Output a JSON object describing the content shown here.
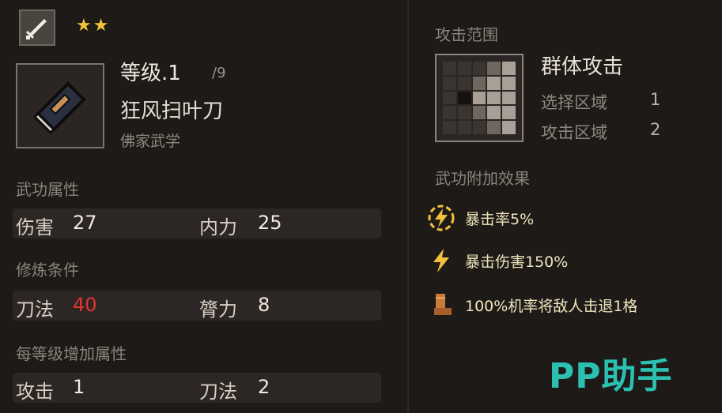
{
  "header": {
    "weapon_icon": "sword-icon",
    "stars": "★★"
  },
  "skill": {
    "book_icon": "book-icon",
    "level": "等级.1",
    "level_max": "/9",
    "name": "狂风扫叶刀",
    "school": "佛家武学"
  },
  "attributes": {
    "label": "武功属性",
    "items": [
      {
        "key": "伤害",
        "value": "27"
      },
      {
        "key": "内力",
        "value": "25"
      }
    ]
  },
  "requirements": {
    "label": "修炼条件",
    "items": [
      {
        "key": "刀法",
        "value": "40",
        "color": "#e53530"
      },
      {
        "key": "膂力",
        "value": "8"
      }
    ]
  },
  "per_level": {
    "label": "每等级增加属性",
    "items": [
      {
        "key": "攻击",
        "value": "1"
      },
      {
        "key": "刀法",
        "value": "2"
      }
    ]
  },
  "attack_range": {
    "label": "攻击范围",
    "type": "群体攻击",
    "select_label": "选择区域",
    "select_value": "1",
    "attack_label": "攻击区域",
    "attack_value": "2"
  },
  "effects": {
    "label": "武功附加效果",
    "items": [
      {
        "icon": "lightning-circle-icon",
        "text": "暴击率5%"
      },
      {
        "icon": "lightning-icon",
        "text": "暴击伤害150%"
      },
      {
        "icon": "boot-icon",
        "text": "100%机率将敌人击退1格"
      }
    ]
  },
  "colors": {
    "background": "#1e1a17",
    "star": "#f3c23b",
    "requirement_unmet": "#e53530",
    "effect_text": "#efe5bd",
    "watermark": "#2bc0b0"
  },
  "watermark": "PP助手"
}
